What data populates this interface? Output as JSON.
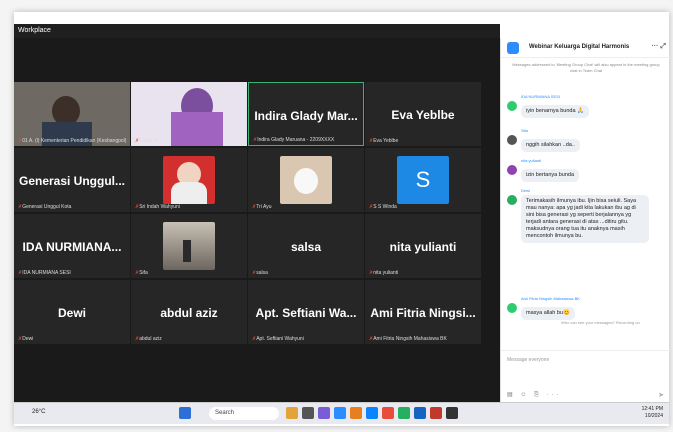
{
  "window": {
    "title": "Workplace"
  },
  "tiles": [
    {
      "name": "",
      "label": "01 A. (l) Kementerian Pendidikan (Kesbangpol)"
    },
    {
      "name": "",
      "label": "Farah R."
    },
    {
      "name": "Indira Glady Mar...",
      "label": "Indira Glady Maruana - 2209XXXX"
    },
    {
      "name": "Eva Yeblbe",
      "label": "Eva Yeblbe"
    },
    {
      "name": "Generasi Unggul...",
      "label": "Generasi Unggul Kota"
    },
    {
      "name": "",
      "label": "Sri Indah Wahyuni"
    },
    {
      "name": "",
      "label": "Tri Ayu"
    },
    {
      "name": "",
      "label": "S S Winda"
    },
    {
      "name": "IDA NURMIANA...",
      "label": "IDA NURMIANA SESI"
    },
    {
      "name": "",
      "label": "Sifa"
    },
    {
      "name": "salsa",
      "label": "salsa"
    },
    {
      "name": "nita yulianti",
      "label": "nita yulianti"
    },
    {
      "name": "Dewi",
      "label": "Dewi"
    },
    {
      "name": "abdul aziz",
      "label": "abdul aziz"
    },
    {
      "name": "Apt. Seftiani Wa...",
      "label": "Apt. Seftiani Wahyuni"
    },
    {
      "name": "Ami Fitria Ningsi...",
      "label": "Ami Fitria Ningsih Mahasiswa BK"
    }
  ],
  "chat": {
    "title": "Webinar Keluarga Digital Harmonis",
    "notice": "Messages addressed to 'Meeting Group Chat' will also appear in the meeting group chat in Team Chat",
    "messages": [
      {
        "sender": "IDA NURMIANA SESI",
        "text": "iyin benarnya bunda 🙏"
      },
      {
        "sender": "Sifa",
        "text": "nggih silahkan ..da.."
      },
      {
        "sender": "nita yulianti",
        "text": "izin bertanya bunda"
      },
      {
        "sender": "Dewi",
        "text": "Terimakasih ilmunya ibu. Ijin bisa seiuli. Saya mau nanya: apa yg jadi kita lakukan ibu ag di sini bisa generasi yg seperti berjalannya yg terjadi antara generasi di atas ...ditiru gitu. maksudnya orang tua itu anaknya masih mencontoh ilmunya bu."
      },
      {
        "sender": "Ami Fitria Ningsih Mahasiswa BK",
        "text": "masya allah bu😊"
      }
    ],
    "divider": "Who can see your messages? Recording on",
    "compose_placeholder": "Message everyone"
  },
  "taskbar": {
    "weather": "26°C",
    "search_placeholder": "Search",
    "time": "12:41 PM",
    "date": "10/2024"
  }
}
